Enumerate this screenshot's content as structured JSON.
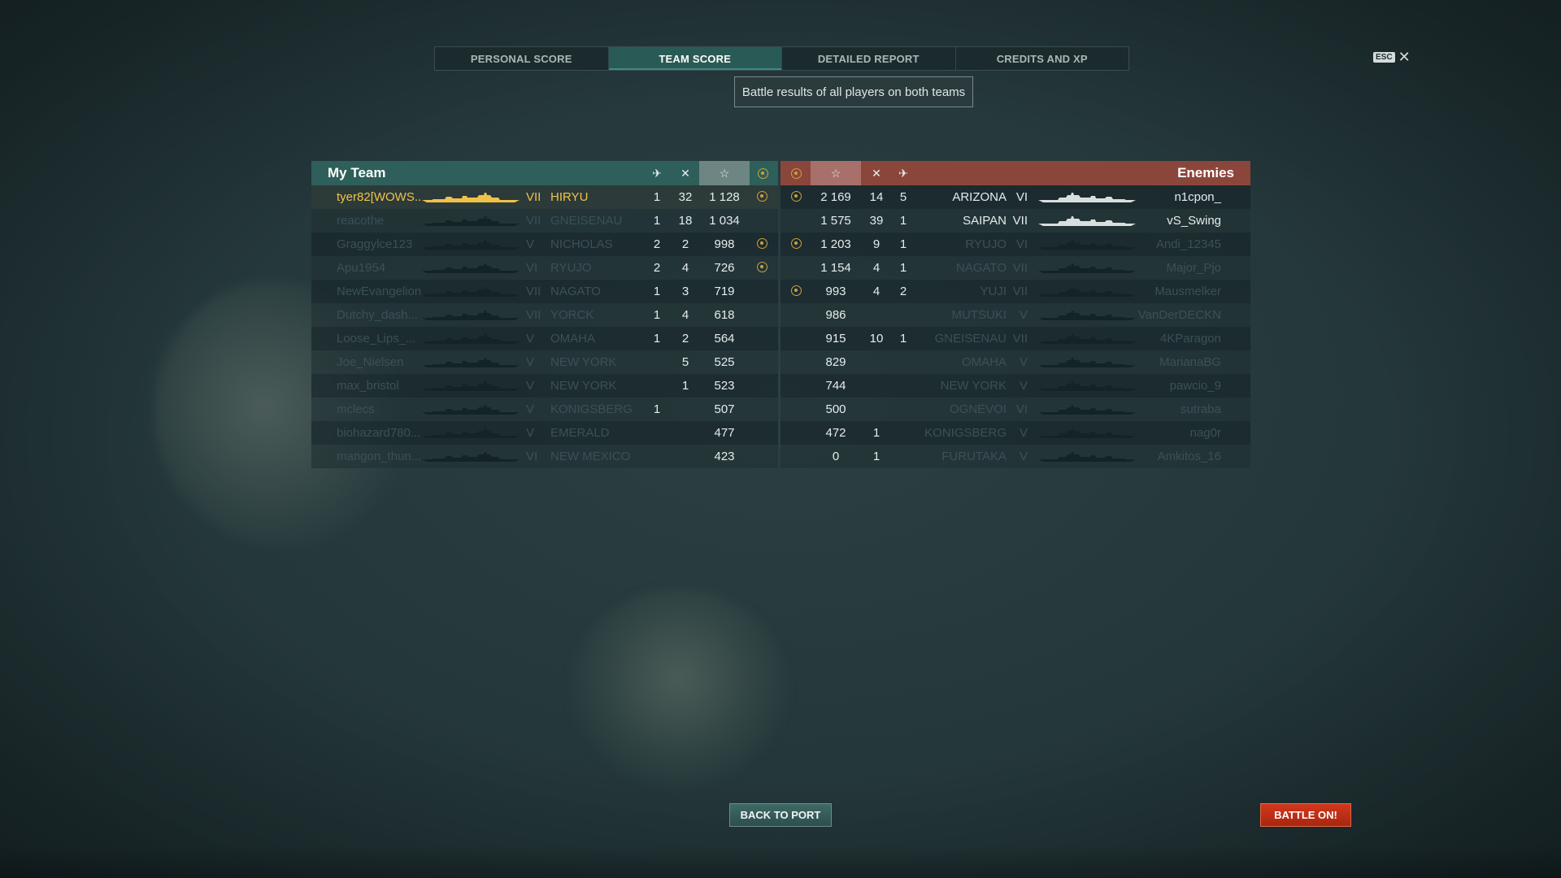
{
  "tabs": [
    {
      "label": "PERSONAL SCORE",
      "active": false
    },
    {
      "label": "TEAM SCORE",
      "active": true
    },
    {
      "label": "DETAILED REPORT",
      "active": false
    },
    {
      "label": "CREDITS AND XP",
      "active": false
    }
  ],
  "tooltip": "Battle results of all players on both teams",
  "esc_key": "ESC",
  "close_glyph": "✕",
  "my_team": {
    "title": "My Team",
    "players": [
      {
        "name": "tyer82[WOWS...",
        "tier": "VII",
        "ship": "HIRYU",
        "planes": "1",
        "kills": "32",
        "xp": "1 128",
        "medal": true,
        "self": true
      },
      {
        "name": "reacothe",
        "tier": "VII",
        "ship": "GNEISENAU",
        "planes": "1",
        "kills": "18",
        "xp": "1 034",
        "medal": false
      },
      {
        "name": "Graggylce123",
        "tier": "V",
        "ship": "NICHOLAS",
        "planes": "2",
        "kills": "2",
        "xp": "998",
        "medal": true
      },
      {
        "name": "Apu1954",
        "tier": "VI",
        "ship": "RYUJO",
        "planes": "2",
        "kills": "4",
        "xp": "726",
        "medal": true
      },
      {
        "name": "NewEvangelion",
        "tier": "VII",
        "ship": "NAGATO",
        "planes": "1",
        "kills": "3",
        "xp": "719",
        "medal": false
      },
      {
        "name": "Dutchy_dash...",
        "tier": "VII",
        "ship": "YORCK",
        "planes": "1",
        "kills": "4",
        "xp": "618",
        "medal": false
      },
      {
        "name": "Loose_Lips_...",
        "tier": "V",
        "ship": "OMAHA",
        "planes": "1",
        "kills": "2",
        "xp": "564",
        "medal": false
      },
      {
        "name": "Joe_Nielsen",
        "tier": "V",
        "ship": "NEW YORK",
        "planes": "",
        "kills": "5",
        "xp": "525",
        "medal": false
      },
      {
        "name": "max_bristol",
        "tier": "V",
        "ship": "NEW YORK",
        "planes": "",
        "kills": "1",
        "xp": "523",
        "medal": false
      },
      {
        "name": "mclecs",
        "tier": "V",
        "ship": "KONIGSBERG",
        "planes": "1",
        "kills": "",
        "xp": "507",
        "medal": false
      },
      {
        "name": "biohazard780...",
        "tier": "V",
        "ship": "EMERALD",
        "planes": "",
        "kills": "",
        "xp": "477",
        "medal": false
      },
      {
        "name": "mangon_thun...",
        "tier": "VI",
        "ship": "NEW MEXICO",
        "planes": "",
        "kills": "",
        "xp": "423",
        "medal": false
      }
    ]
  },
  "enemies": {
    "title": "Enemies",
    "players": [
      {
        "medal": true,
        "xp": "2 169",
        "kills": "14",
        "planes": "5",
        "ship": "ARIZONA",
        "tier": "VI",
        "name": "n1cpon_",
        "visible": true
      },
      {
        "medal": false,
        "xp": "1 575",
        "kills": "39",
        "planes": "1",
        "ship": "SAIPAN",
        "tier": "VII",
        "name": "vS_Swing",
        "visible": true
      },
      {
        "medal": true,
        "xp": "1 203",
        "kills": "9",
        "planes": "1",
        "ship": "RYUJO",
        "tier": "VI",
        "name": "Andi_12345",
        "visible": false
      },
      {
        "medal": false,
        "xp": "1 154",
        "kills": "4",
        "planes": "1",
        "ship": "NAGATO",
        "tier": "VII",
        "name": "Major_Pjo",
        "visible": false
      },
      {
        "medal": true,
        "xp": "993",
        "kills": "4",
        "planes": "2",
        "ship": "YUJI",
        "tier": "VII",
        "name": "Mausmelker",
        "visible": false
      },
      {
        "medal": false,
        "xp": "986",
        "kills": "",
        "planes": "",
        "ship": "MUTSUKI",
        "tier": "V",
        "name": "VanDerDECKN",
        "visible": false
      },
      {
        "medal": false,
        "xp": "915",
        "kills": "10",
        "planes": "1",
        "ship": "GNEISENAU",
        "tier": "VII",
        "name": "4KParagon",
        "visible": false
      },
      {
        "medal": false,
        "xp": "829",
        "kills": "",
        "planes": "",
        "ship": "OMAHA",
        "tier": "V",
        "name": "MarianaBG",
        "visible": false
      },
      {
        "medal": false,
        "xp": "744",
        "kills": "",
        "planes": "",
        "ship": "NEW YORK",
        "tier": "V",
        "name": "pawcio_9",
        "visible": false
      },
      {
        "medal": false,
        "xp": "500",
        "kills": "",
        "planes": "",
        "ship": "OGNEVOI",
        "tier": "VI",
        "name": "sutraba",
        "visible": false
      },
      {
        "medal": false,
        "xp": "472",
        "kills": "1",
        "planes": "",
        "ship": "KONIGSBERG",
        "tier": "V",
        "name": "nag0r",
        "visible": false
      },
      {
        "medal": false,
        "xp": "0",
        "kills": "1",
        "planes": "",
        "ship": "FURUTAKA",
        "tier": "V",
        "name": "Amkitos_16",
        "visible": false
      }
    ]
  },
  "buttons": {
    "back_to_port": "BACK TO PORT",
    "battle_on": "BATTLE ON!"
  },
  "icons": {
    "plane": "✈",
    "kills": "✕",
    "xp": "☆",
    "medal": "coin"
  }
}
